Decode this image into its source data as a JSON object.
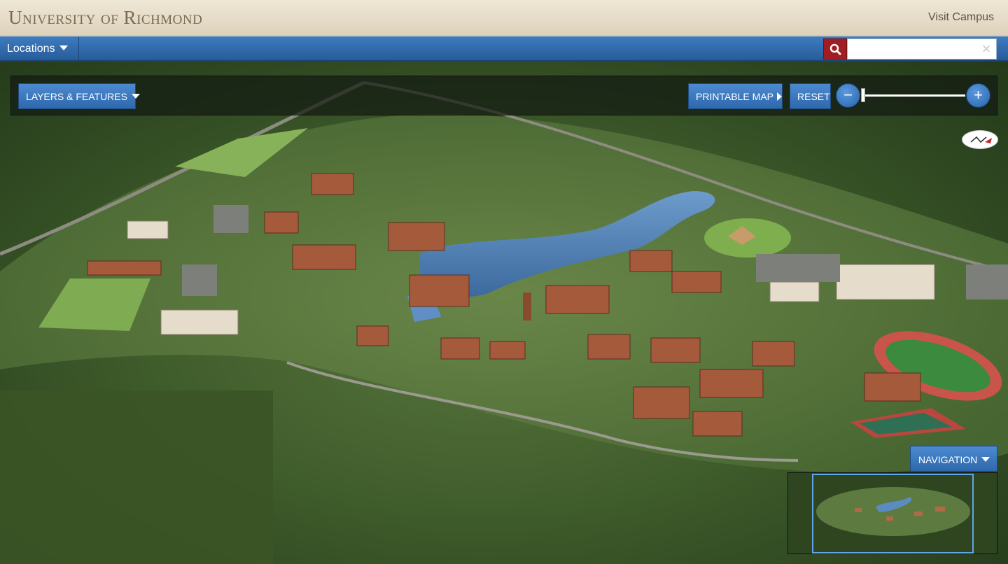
{
  "header": {
    "brand": "University of Richmond",
    "visit_link": "Visit Campus"
  },
  "navbar": {
    "locations_label": "Locations",
    "search": {
      "value": "",
      "placeholder": "",
      "clear_glyph": "×"
    }
  },
  "toolbar": {
    "layers_label": "Layers & Features",
    "printable_label": "Printable Map",
    "reset_label": "Reset",
    "zoom_out_glyph": "−",
    "zoom_in_glyph": "+",
    "zoom_level_fraction": 0.0
  },
  "navigation_panel": {
    "toggle_label": "Navigation"
  },
  "colors": {
    "brand_text": "#7a6a55",
    "nav_blue": "#2e68ad",
    "search_red": "#a01d22",
    "lake": "#4f7fb3",
    "forest": "#3f5c2b"
  },
  "icons": {
    "search": "magnifier-icon",
    "compass": "compass-icon",
    "dropdown": "caret-down-icon"
  }
}
